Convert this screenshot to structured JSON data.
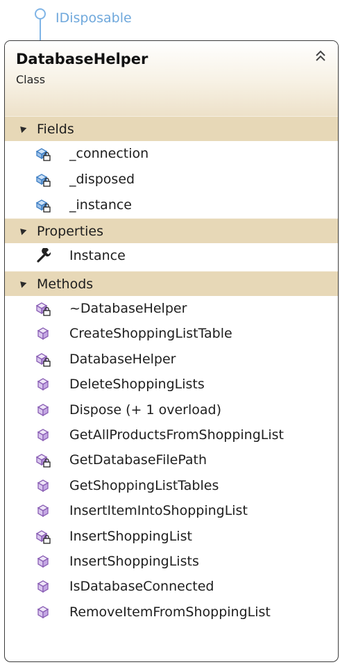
{
  "interface": {
    "name": "IDisposable"
  },
  "class": {
    "name": "DatabaseHelper",
    "kind": "Class"
  },
  "sections": {
    "fields": {
      "label": "Fields",
      "items": [
        {
          "name": "_connection",
          "icon": "private-field-icon"
        },
        {
          "name": "_disposed",
          "icon": "private-field-icon"
        },
        {
          "name": "_instance",
          "icon": "private-field-icon"
        }
      ]
    },
    "properties": {
      "label": "Properties",
      "items": [
        {
          "name": "Instance",
          "icon": "property-wrench-icon"
        }
      ]
    },
    "methods": {
      "label": "Methods",
      "items": [
        {
          "name": "~DatabaseHelper",
          "icon": "private-method-icon"
        },
        {
          "name": "CreateShoppingListTable",
          "icon": "public-method-icon"
        },
        {
          "name": "DatabaseHelper",
          "icon": "private-method-icon"
        },
        {
          "name": "DeleteShoppingLists",
          "icon": "public-method-icon"
        },
        {
          "name": "Dispose (+ 1 overload)",
          "icon": "public-method-icon"
        },
        {
          "name": "GetAllProductsFromShoppingList",
          "icon": "public-method-icon"
        },
        {
          "name": "GetDatabaseFilePath",
          "icon": "private-method-icon"
        },
        {
          "name": "GetShoppingListTables",
          "icon": "public-method-icon"
        },
        {
          "name": "InsertItemIntoShoppingList",
          "icon": "public-method-icon"
        },
        {
          "name": "InsertShoppingList",
          "icon": "private-method-icon"
        },
        {
          "name": "InsertShoppingLists",
          "icon": "public-method-icon"
        },
        {
          "name": "IsDatabaseConnected",
          "icon": "public-method-icon"
        },
        {
          "name": "RemoveItemFromShoppingList",
          "icon": "public-method-icon"
        }
      ]
    }
  },
  "colors": {
    "section_bg": "#e7d8b7",
    "interface_blue": "#6fa8dc",
    "method_purple": "#8a5fb5",
    "field_blue": "#3f7fc4"
  }
}
